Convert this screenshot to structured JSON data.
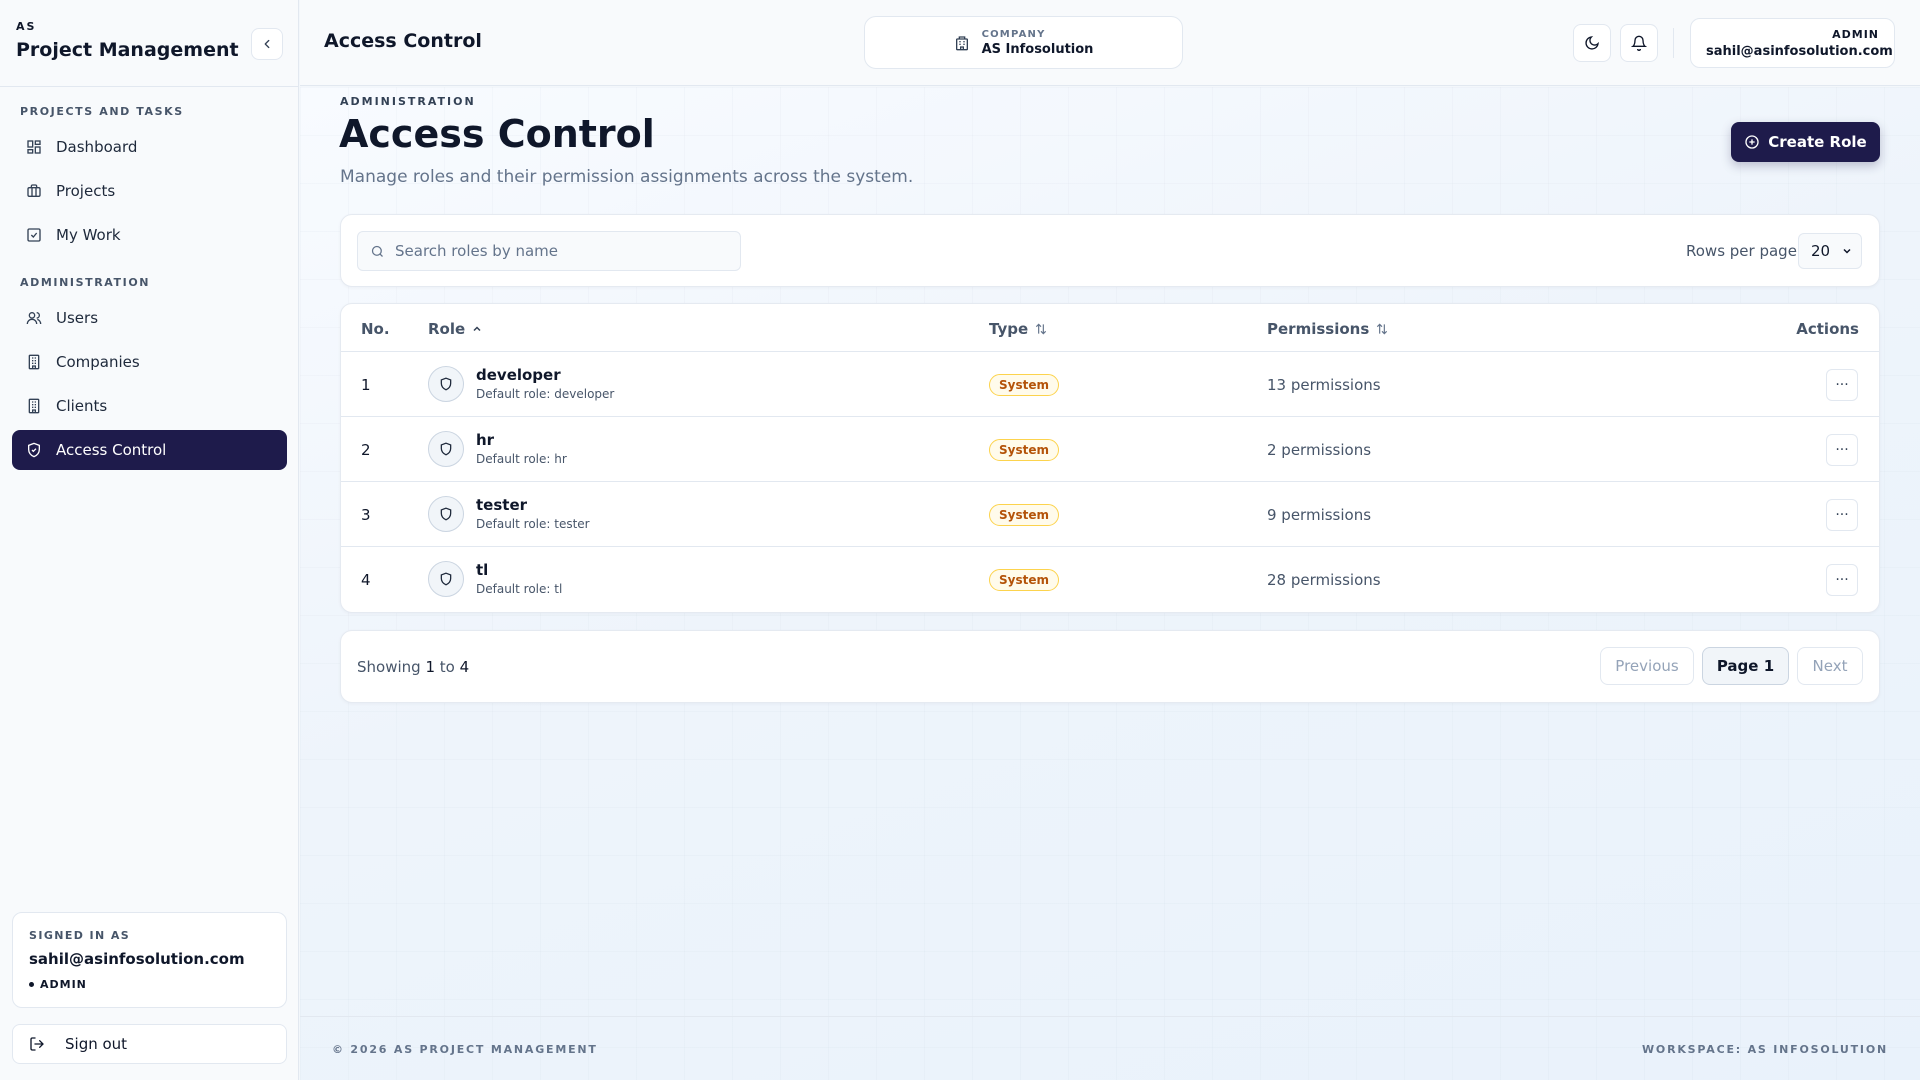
{
  "brand": {
    "small": "AS",
    "title": "Project Management"
  },
  "sidebar": {
    "sections": [
      {
        "label": "PROJECTS AND TASKS"
      },
      {
        "label": "ADMINISTRATION"
      }
    ],
    "items": [
      {
        "label": "Dashboard",
        "icon": "dashboard-icon"
      },
      {
        "label": "Projects",
        "icon": "briefcase-icon"
      },
      {
        "label": "My Work",
        "icon": "checkbox-icon"
      },
      {
        "label": "Users",
        "icon": "users-icon"
      },
      {
        "label": "Companies",
        "icon": "building-icon"
      },
      {
        "label": "Clients",
        "icon": "building-icon"
      },
      {
        "label": "Access Control",
        "icon": "shield-check-icon",
        "active": true
      }
    ],
    "signed_in": {
      "label": "SIGNED IN AS",
      "email": "sahil@asinfosolution.com",
      "role": "ADMIN"
    },
    "sign_out": "Sign out"
  },
  "header": {
    "title": "Access Control",
    "company_label": "COMPANY",
    "company_name": "AS Infosolution",
    "user_role": "ADMIN",
    "user_email": "sahil@asinfosolution.com"
  },
  "page": {
    "eyebrow": "ADMINISTRATION",
    "title": "Access Control",
    "subtitle": "Manage roles and their permission assignments across the system.",
    "create_button": "Create Role"
  },
  "toolbar": {
    "search_placeholder": "Search roles by name",
    "rows_label": "Rows per page",
    "rows_value": "20"
  },
  "table": {
    "columns": {
      "no": "No.",
      "role": "Role",
      "type": "Type",
      "permissions": "Permissions",
      "actions": "Actions"
    },
    "rows": [
      {
        "no": "1",
        "name": "developer",
        "desc": "Default role: developer",
        "type": "System",
        "permissions": "13 permissions"
      },
      {
        "no": "2",
        "name": "hr",
        "desc": "Default role: hr",
        "type": "System",
        "permissions": "2 permissions"
      },
      {
        "no": "3",
        "name": "tester",
        "desc": "Default role: tester",
        "type": "System",
        "permissions": "9 permissions"
      },
      {
        "no": "4",
        "name": "tl",
        "desc": "Default role: tl",
        "type": "System",
        "permissions": "28 permissions"
      }
    ],
    "action_glyph": "···"
  },
  "pagination": {
    "showing_prefix": "Showing",
    "from": "1",
    "to_word": "to",
    "to": "4",
    "previous": "Previous",
    "current": "Page 1",
    "next": "Next"
  },
  "footer": {
    "left": "© 2026 AS PROJECT MANAGEMENT",
    "right": "WORKSPACE: AS INFOSOLUTION"
  },
  "colors": {
    "accent": "#1e1b4b",
    "badge_bg": "#fffbeb",
    "badge_text": "#b45309"
  }
}
